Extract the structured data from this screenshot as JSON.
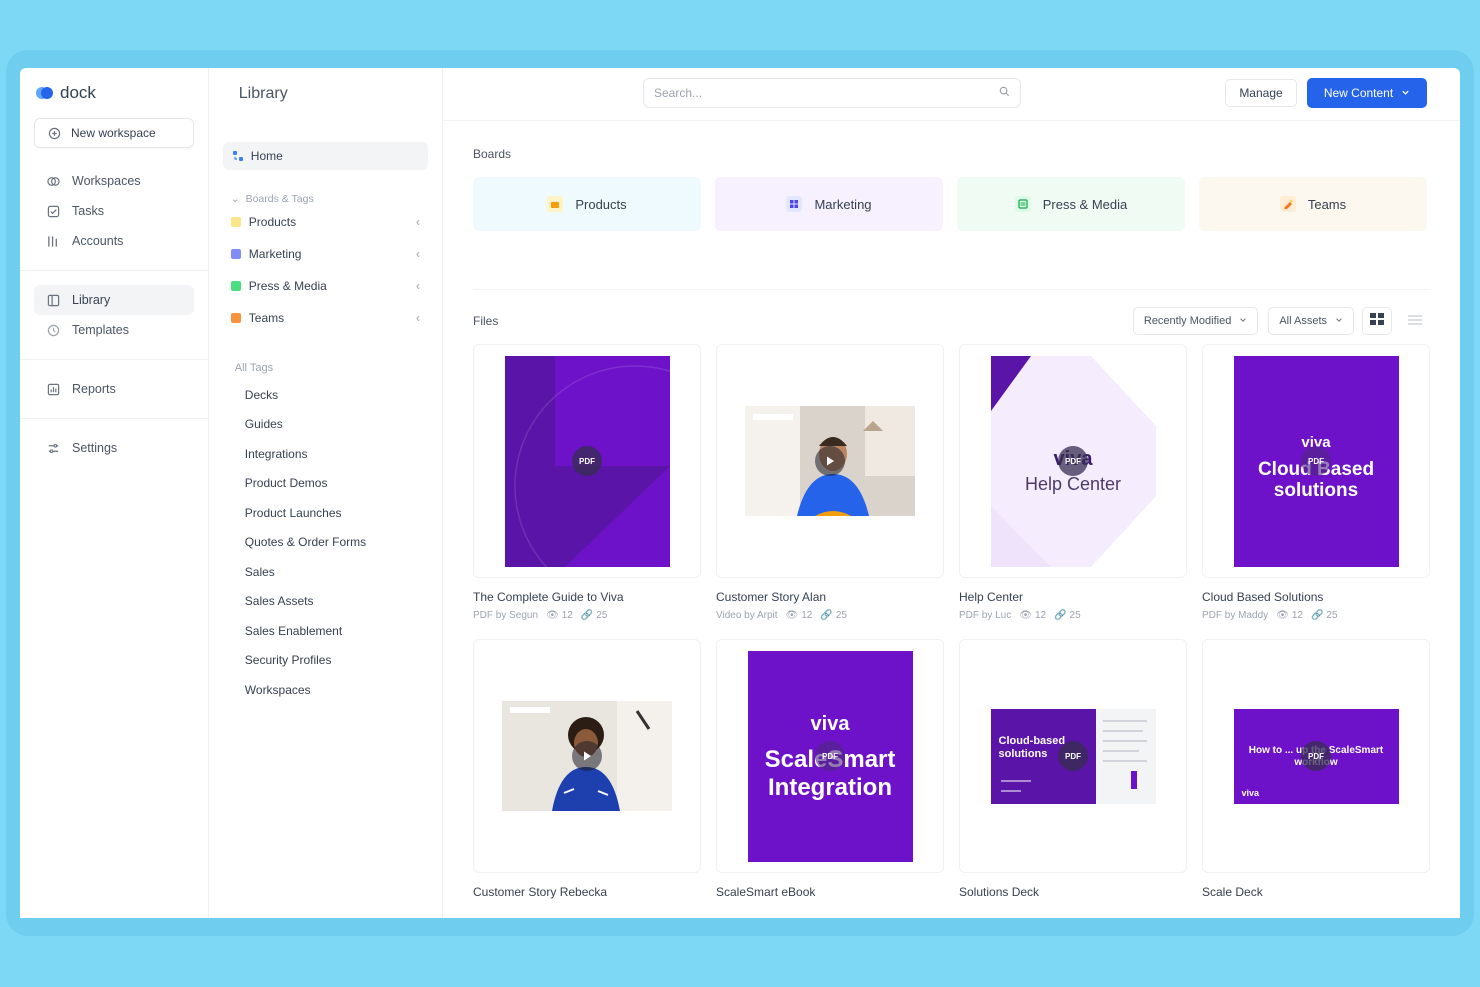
{
  "brand": {
    "name": "dock"
  },
  "nav": {
    "new_workspace": "New workspace",
    "group1": [
      {
        "label": "Workspaces",
        "icon": "workspaces-icon"
      },
      {
        "label": "Tasks",
        "icon": "tasks-icon"
      },
      {
        "label": "Accounts",
        "icon": "accounts-icon"
      }
    ],
    "group2": [
      {
        "label": "Library",
        "icon": "library-icon",
        "active": true
      },
      {
        "label": "Templates",
        "icon": "templates-icon"
      }
    ],
    "group3": [
      {
        "label": "Reports",
        "icon": "reports-icon"
      }
    ],
    "group4": [
      {
        "label": "Settings",
        "icon": "settings-icon"
      }
    ]
  },
  "header": {
    "title": "Library",
    "search_placeholder": "Search...",
    "manage_label": "Manage",
    "new_content_label": "New Content"
  },
  "tree": {
    "home": "Home",
    "boards_tags": "Boards & Tags",
    "boards": [
      {
        "label": "Products",
        "color": "#fde68a"
      },
      {
        "label": "Marketing",
        "color": "#818cf8"
      },
      {
        "label": "Press & Media",
        "color": "#4ade80"
      },
      {
        "label": "Teams",
        "color": "#fb923c"
      }
    ],
    "all_tags": "All Tags",
    "tags": [
      "Decks",
      "Guides",
      "Integrations",
      "Product Demos",
      "Product Launches",
      "Quotes & Order Forms",
      "Sales",
      "Sales Assets",
      "Sales Enablement",
      "Security Profiles",
      "Workspaces"
    ]
  },
  "boards_section": {
    "label": "Boards",
    "items": [
      {
        "label": "Products",
        "bg": "#effafe",
        "icon_bg": "#fef3c7"
      },
      {
        "label": "Marketing",
        "bg": "#f7f0fe",
        "icon_bg": "#e0e7ff"
      },
      {
        "label": "Press & Media",
        "bg": "#f0fbf3",
        "icon_bg": "#dcfce7"
      },
      {
        "label": "Teams",
        "bg": "#fdf8ef",
        "icon_bg": "#ffedd5"
      }
    ]
  },
  "files_section": {
    "label": "Files",
    "sort_label": "Recently Modified",
    "filter_label": "All Assets"
  },
  "files": [
    {
      "title": "The Complete Guide to Viva",
      "meta": "PDF by Segun",
      "views": "12",
      "links": "25"
    },
    {
      "title": "Customer Story Alan",
      "meta": "Video by Arpit",
      "views": "12",
      "links": "25"
    },
    {
      "title": "Help Center",
      "meta": "PDF by Luc",
      "views": "12",
      "links": "25"
    },
    {
      "title": "Cloud Based Solutions",
      "meta": "PDF by Maddy",
      "views": "12",
      "links": "25"
    },
    {
      "title": "Customer Story Rebecka"
    },
    {
      "title": "ScaleSmart eBook"
    },
    {
      "title": "Solutions Deck"
    },
    {
      "title": "Scale Deck"
    }
  ],
  "thumb_text": {
    "pdf": "PDF",
    "viva": "viva",
    "help_center": "Help Center",
    "cloud_based": "Cloud Based solutions",
    "scale_title": "ScaleSmart Integration",
    "deck_title": "Cloud-based solutions",
    "scale_deck_title": "How to ... up the ScaleSmart workflow"
  },
  "colors": {
    "accent": "#2563eb",
    "purple": "#6d12c9",
    "purple_dark": "#5a14a8"
  }
}
